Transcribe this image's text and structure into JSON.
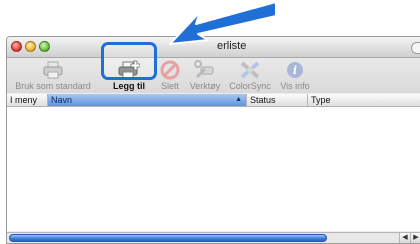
{
  "window": {
    "title": "erliste"
  },
  "toolbar": {
    "items": [
      {
        "label": "Bruk som standard",
        "icon": "printer-default-icon"
      },
      {
        "label": "Legg til",
        "icon": "add-printer-icon"
      },
      {
        "label": "Slett",
        "icon": "delete-icon"
      },
      {
        "label": "Verktøy",
        "icon": "utility-icon"
      },
      {
        "label": "ColorSync",
        "icon": "colorsync-icon"
      },
      {
        "label": "Vis info",
        "icon": "info-icon"
      }
    ]
  },
  "list": {
    "columns": [
      "I meny",
      "Navn",
      "Status",
      "Type"
    ],
    "sorted_column": "Navn"
  },
  "colors": {
    "highlight": "#1f6fd6",
    "arrow": "#1f6fd6"
  }
}
